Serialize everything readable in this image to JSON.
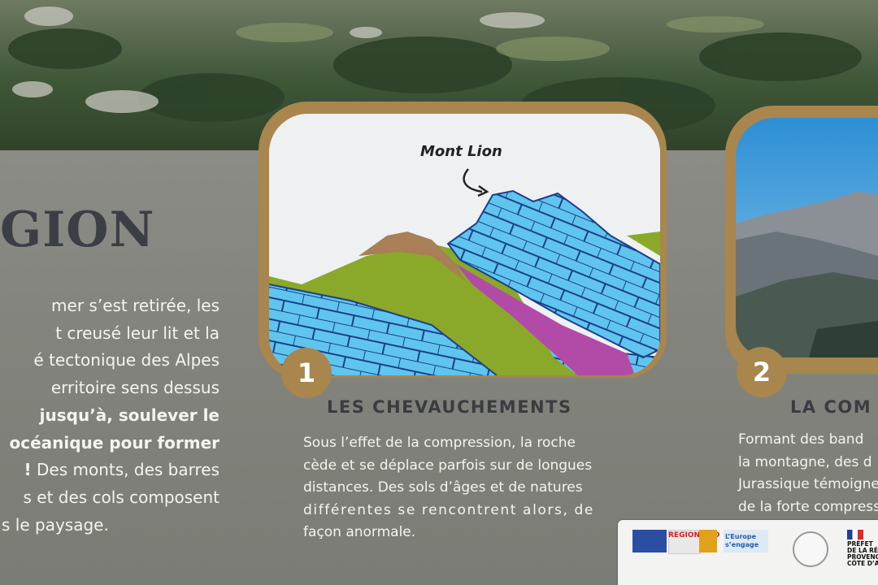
{
  "left_panel": {
    "title": "GION",
    "lines": [
      "mer s’est retirée, les",
      "t creusé leur lit et la",
      "é tectonique des Alpes",
      "erritoire sens dessus",
      "jusqu’à, soulever le",
      "océanique pour former",
      "!",
      "Des monts, des barres",
      "s et des cols composent",
      "s le paysage."
    ]
  },
  "section1": {
    "number": "1",
    "title": "LES CHEVAUCHEMENTS",
    "illustration_label": "Mont Lion",
    "lines": [
      "Sous l’effet de la compression, la roche",
      "cède et se déplace parfois sur de longues",
      "distances. Des sols d’âges et de natures",
      "différentes se rencontrent alors, de",
      "façon anormale."
    ]
  },
  "section2": {
    "number": "2",
    "title": "LA COM",
    "lines": [
      "Formant des band",
      "la montagne, des d",
      "Jurassique témoigne",
      "de la forte compress"
    ]
  },
  "logos": {
    "region": "REGION SUD",
    "europe": "L’Europe s’engage",
    "prefet_lines": [
      "PRÉFET",
      "DE LA RÉG",
      "PROVENC",
      "CÔTE D’AZ"
    ]
  },
  "colors": {
    "panel": "#83847d",
    "frame_gold": "#a8864d",
    "rock_blue": "#5fc5ee",
    "layer_green": "#8aa82a",
    "layer_magenta": "#b24aa7",
    "layer_brown": "#a87f56"
  }
}
